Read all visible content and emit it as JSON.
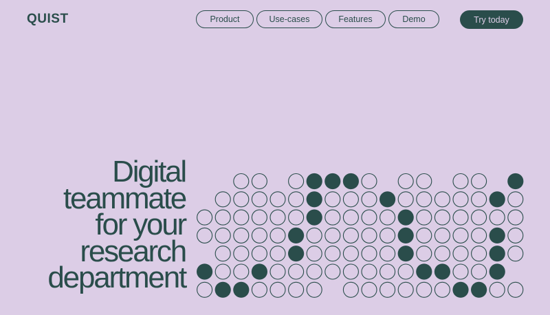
{
  "header": {
    "logo_text": "QUIST",
    "nav_items": [
      {
        "label": "Product"
      },
      {
        "label": "Use-cases"
      },
      {
        "label": "Features"
      },
      {
        "label": "Demo"
      }
    ],
    "cta_label": "Try today"
  },
  "hero": {
    "lines": [
      "Digital",
      "teammate",
      "for your",
      "research",
      "department"
    ]
  },
  "colors": {
    "background": "#dccde6",
    "primary": "#2a4d4b",
    "outline": "#2a4d4b"
  },
  "dot_grid": {
    "rows": [
      "...oo.offfo.oo.oo.f",
      "..ooooofooofooooofo",
      ".oooooofoooofoooooo",
      ".ooooofooooofoooofo",
      "..oooofooooofoooofo",
      ".foofooooooooffoof.",
      ".offoooo.ooooooffoo"
    ]
  }
}
